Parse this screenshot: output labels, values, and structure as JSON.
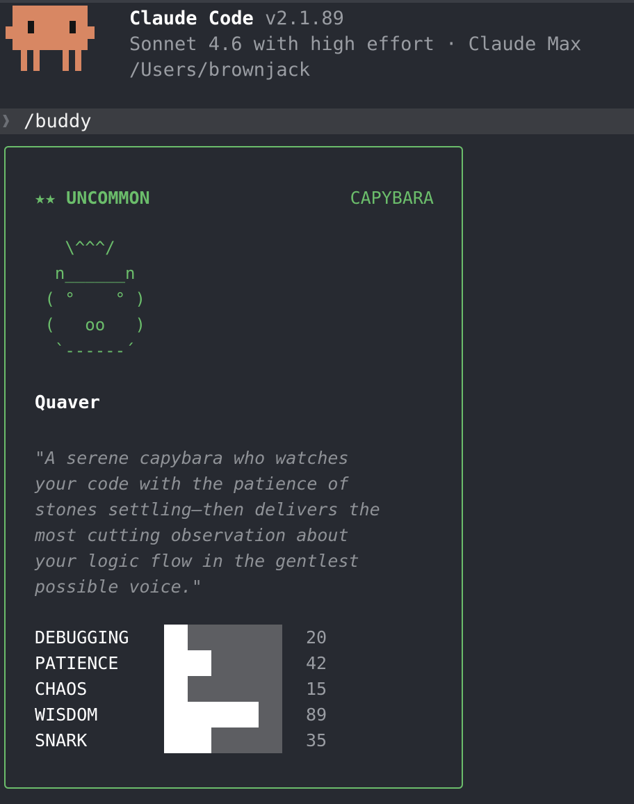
{
  "header": {
    "app_name": "Claude Code",
    "version": "v2.1.89",
    "model_line": "Sonnet 4.6 with high effort · Claude Max",
    "cwd": "/Users/brownjack"
  },
  "prompt": {
    "caret": "❱",
    "command": "/buddy"
  },
  "card": {
    "rarity": "★★ UNCOMMON",
    "species": "CAPYBARA",
    "ascii_art": "   \\^^^/\n  n______n\n ( °    ° )\n (   oo   )\n  `------´",
    "name": "Quaver",
    "description": "\"A serene capybara who watches\nyour code with the patience of\nstones settling—then delivers the\nmost cutting observation about\nyour logic flow in the gentlest\npossible voice.\"",
    "stats": [
      {
        "label": "DEBUGGING",
        "value": 20
      },
      {
        "label": "PATIENCE",
        "value": 42
      },
      {
        "label": "CHAOS",
        "value": 15
      },
      {
        "label": "WISDOM",
        "value": 89
      },
      {
        "label": "SNARK",
        "value": 35
      }
    ]
  },
  "colors": {
    "accent": "#6bbd6b",
    "mascot": "#d88763",
    "background": "#272a31"
  }
}
